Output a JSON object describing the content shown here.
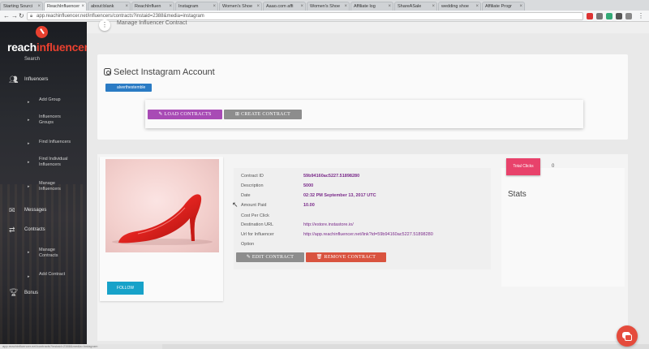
{
  "browser": {
    "tabs": [
      {
        "label": "Starting Sourci",
        "active": false
      },
      {
        "label": "ReachInfluencer",
        "active": true
      },
      {
        "label": "about:blank",
        "active": false
      },
      {
        "label": "ReachInfluen",
        "active": false
      },
      {
        "label": "Instagram",
        "active": false
      },
      {
        "label": "Women's Shoe",
        "active": false
      },
      {
        "label": "Aaao.com affi",
        "active": false
      },
      {
        "label": "Women's Shoe",
        "active": false
      },
      {
        "label": "Affiliate log",
        "active": false
      },
      {
        "label": "ShareASale",
        "active": false
      },
      {
        "label": "wedding shoe",
        "active": false
      },
      {
        "label": "Affiliate Progr",
        "active": false
      }
    ],
    "url": "app.reachinfluencer.net/influencers/contracts?instaid=2388&media=instagram",
    "status_url": "app.reachinfluencer.net/contracts?instaid=2388&media=instagram"
  },
  "sidebar": {
    "logo_main": "reach",
    "logo_accent": "influencer",
    "search_label": "Search",
    "items": [
      {
        "label": "Influencers",
        "icon": "users-icon"
      },
      {
        "label": "Messages",
        "icon": "envelope-icon"
      },
      {
        "label": "Contracts",
        "icon": "arrows-icon"
      },
      {
        "label": "Bonus",
        "icon": "trophy-icon"
      }
    ],
    "sub_items": [
      {
        "label": "Add Group"
      },
      {
        "label": "Influencers Groups"
      },
      {
        "label": "Find Influencers"
      },
      {
        "label": "Find Individual Influencers"
      },
      {
        "label": "Manage Influencers"
      },
      {
        "label": "Manage Contracts"
      },
      {
        "label": "Add Contract"
      }
    ]
  },
  "header": {
    "title": "Manage Influencer Contract"
  },
  "select_account": {
    "title": "Select Instagram Account",
    "account": "alverthestemble",
    "load_button": "LOAD CONTRACTS",
    "create_button": "CREATE CONTRACT"
  },
  "contract": {
    "fields": [
      {
        "label": "Contract ID",
        "value": "59b94160ac5227.51898280",
        "bold": true
      },
      {
        "label": "Description",
        "value": "5000",
        "bold": true
      },
      {
        "label": "Date",
        "value": "02:32 PM September 13, 2017 UTC",
        "bold": true
      },
      {
        "label": "Amount Paid",
        "value": "10.00",
        "bold": true
      },
      {
        "label": "Cost Per Click",
        "value": "",
        "bold": false
      },
      {
        "label": "Destination URL",
        "value": "http://estore.instastore.io/",
        "bold": false
      },
      {
        "label": "Url for Influencer",
        "value": "http://app.reachinfluencer.net/link?id=59b94160ac5227.51898280",
        "bold": false
      },
      {
        "label": "Option",
        "value": "",
        "bold": false
      }
    ],
    "edit_button": "EDIT CONTRACT",
    "remove_button": "REMOVE CONTRACT",
    "follow_button": "FOLLOW"
  },
  "stats": {
    "title": "Stats",
    "total_clicks_label": "Total Clicks",
    "total_clicks_value": "0"
  },
  "colors": {
    "purple": "#a84bb5",
    "gray": "#8d8d8d",
    "blue": "#2a7bc4",
    "cyan": "#17a2c9",
    "red": "#d9533f",
    "pink": "#e8426b"
  }
}
